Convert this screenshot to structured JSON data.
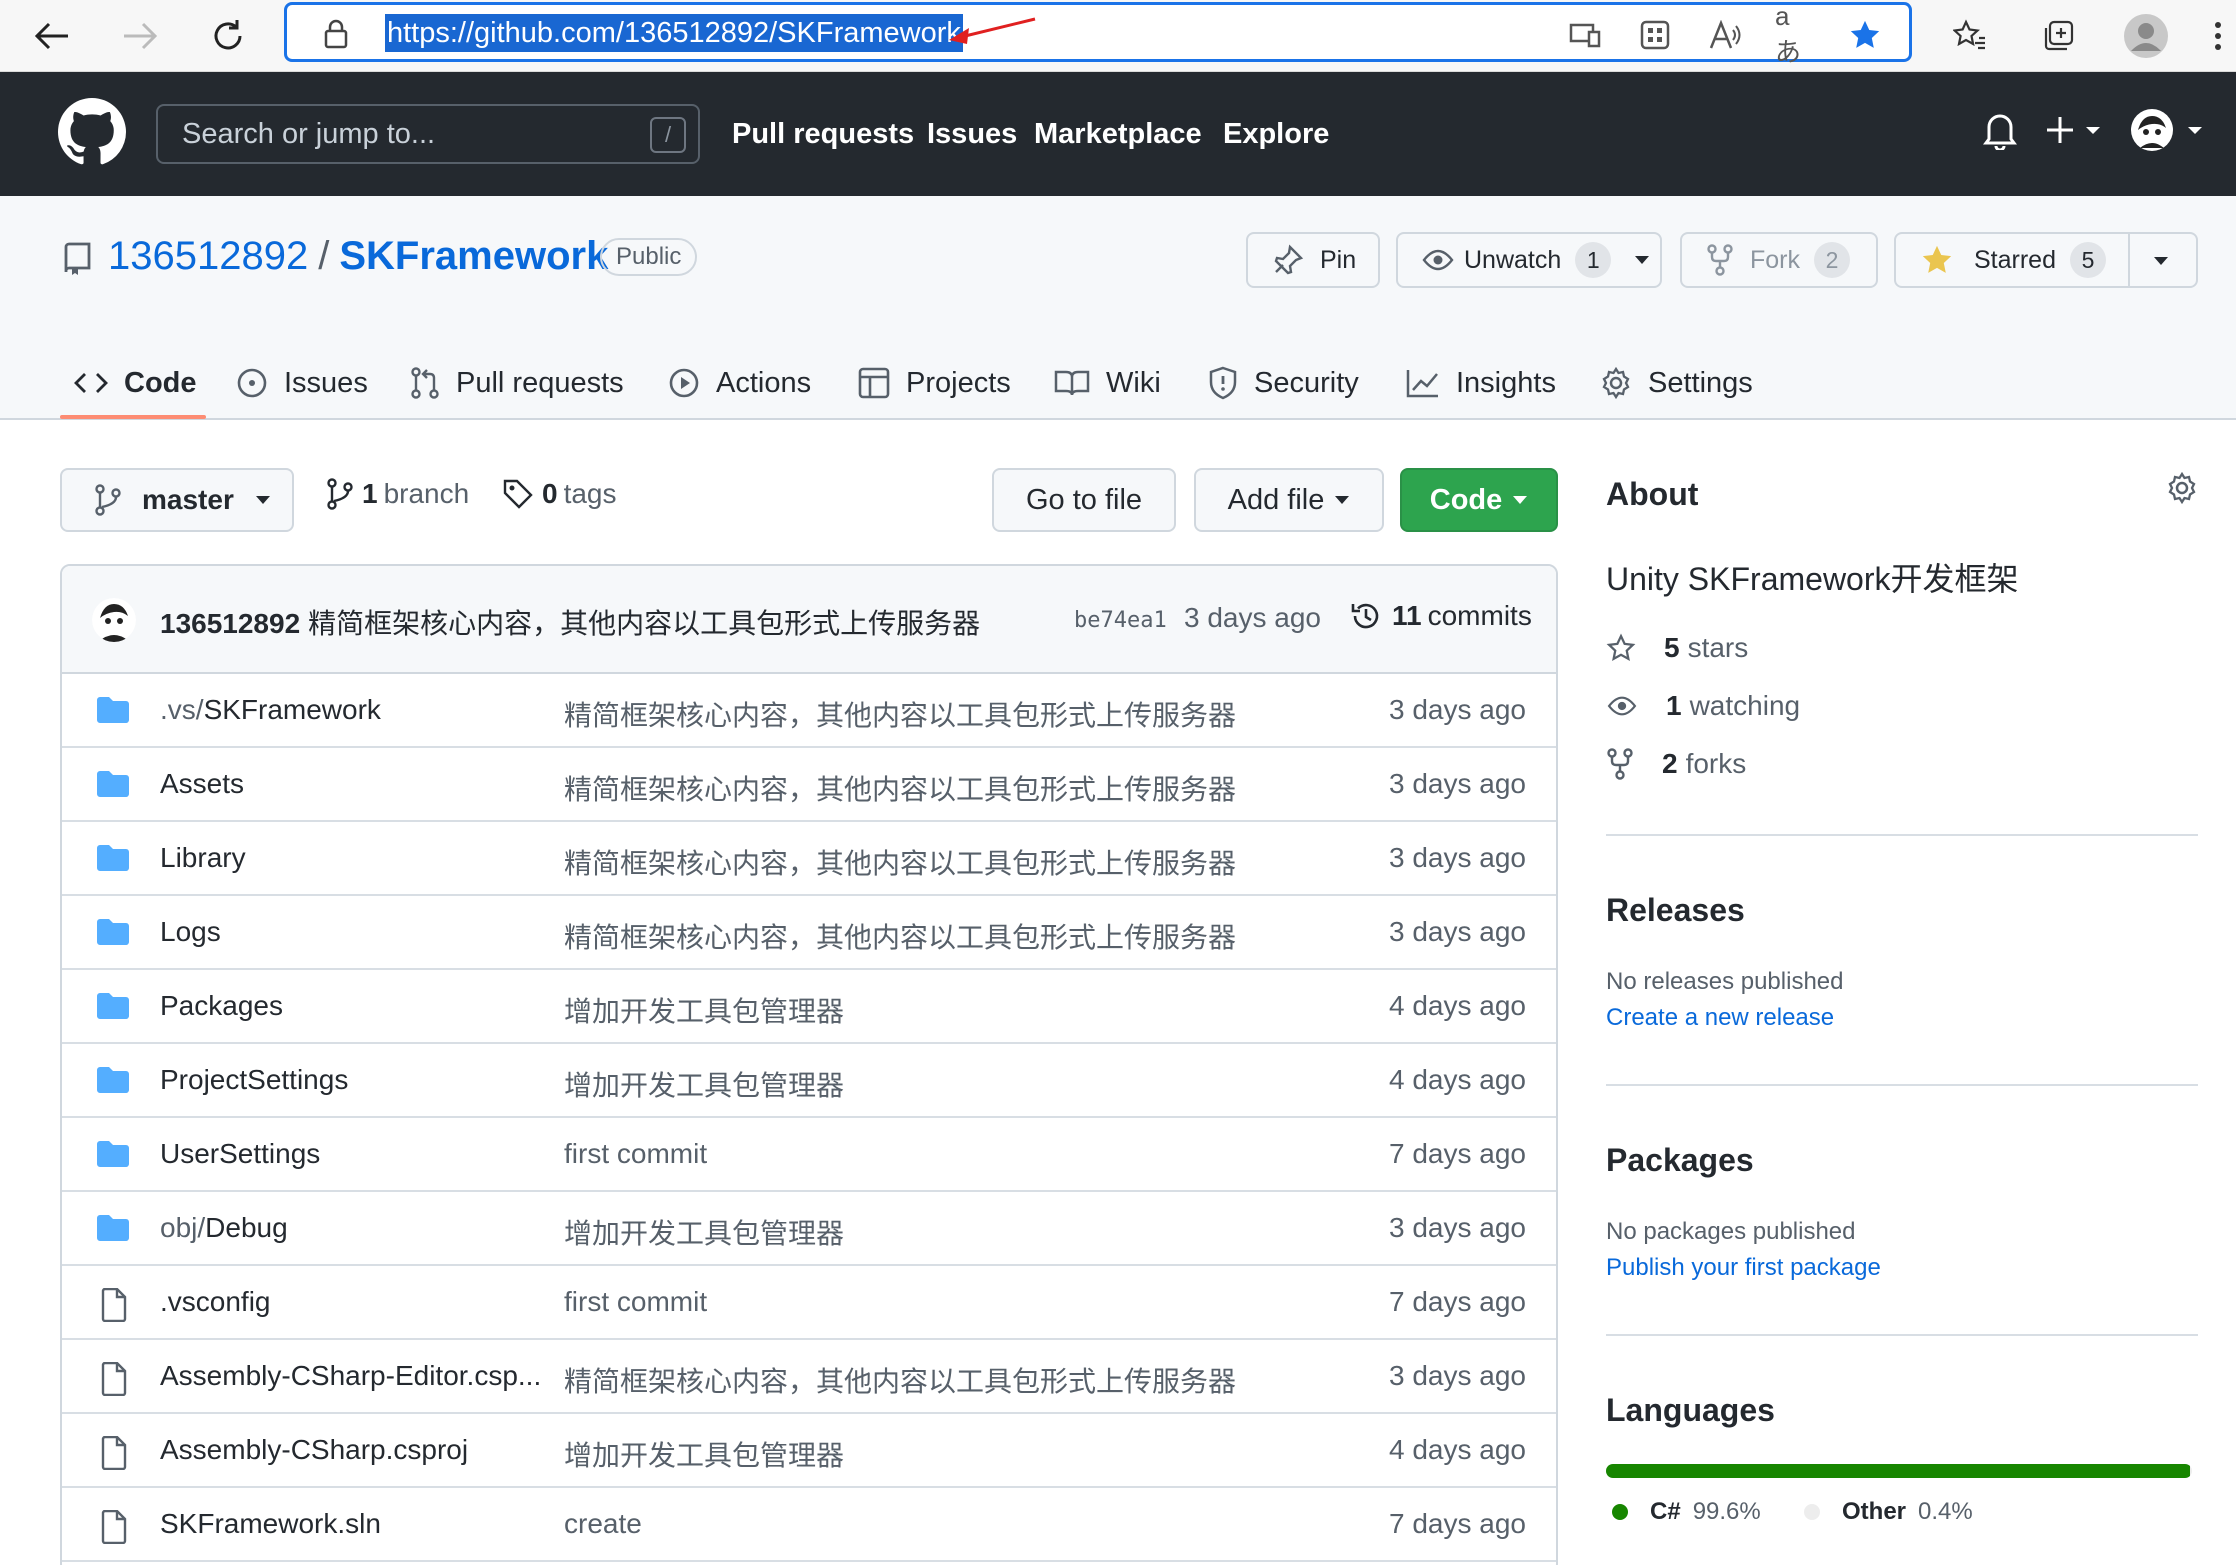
{
  "browser": {
    "url": "https://github.com/136512892/SKFramework",
    "translate_icon_text": "aあ"
  },
  "github_header": {
    "search_placeholder": "Search or jump to...",
    "search_shortcut": "/",
    "nav": [
      "Pull requests",
      "Issues",
      "Marketplace",
      "Explore"
    ]
  },
  "repo": {
    "owner": "136512892",
    "separator": "/",
    "name": "SKFramework",
    "visibility": "Public",
    "pin_label": "Pin",
    "watch_label": "Unwatch",
    "watch_count": "1",
    "fork_label": "Fork",
    "fork_count": "2",
    "star_label": "Starred",
    "star_count": "5"
  },
  "tabs": [
    "Code",
    "Issues",
    "Pull requests",
    "Actions",
    "Projects",
    "Wiki",
    "Security",
    "Insights",
    "Settings"
  ],
  "toolbar": {
    "branch": "master",
    "branch_count": "1",
    "branch_word": "branch",
    "tag_count": "0",
    "tag_word": "tags",
    "go_to_file": "Go to file",
    "add_file": "Add file",
    "code": "Code"
  },
  "latest_commit": {
    "author": "136512892",
    "message": "精简框架核心内容，其他内容以工具包形式上传服务器",
    "sha": "be74ea1",
    "age": "3 days ago",
    "commit_count": "11",
    "commit_word": "commits"
  },
  "files": [
    {
      "type": "dir",
      "dim": ".vs/",
      "name": "SKFramework",
      "message": "精简框架核心内容，其他内容以工具包形式上传服务器",
      "age": "3 days ago"
    },
    {
      "type": "dir",
      "dim": "",
      "name": "Assets",
      "message": "精简框架核心内容，其他内容以工具包形式上传服务器",
      "age": "3 days ago"
    },
    {
      "type": "dir",
      "dim": "",
      "name": "Library",
      "message": "精简框架核心内容，其他内容以工具包形式上传服务器",
      "age": "3 days ago"
    },
    {
      "type": "dir",
      "dim": "",
      "name": "Logs",
      "message": "精简框架核心内容，其他内容以工具包形式上传服务器",
      "age": "3 days ago"
    },
    {
      "type": "dir",
      "dim": "",
      "name": "Packages",
      "message": "增加开发工具包管理器",
      "age": "4 days ago"
    },
    {
      "type": "dir",
      "dim": "",
      "name": "ProjectSettings",
      "message": "增加开发工具包管理器",
      "age": "4 days ago"
    },
    {
      "type": "dir",
      "dim": "",
      "name": "UserSettings",
      "message": "first commit",
      "age": "7 days ago"
    },
    {
      "type": "dir",
      "dim": "obj/",
      "name": "Debug",
      "message": "增加开发工具包管理器",
      "age": "3 days ago"
    },
    {
      "type": "file",
      "dim": "",
      "name": ".vsconfig",
      "message": "first commit",
      "age": "7 days ago"
    },
    {
      "type": "file",
      "dim": "",
      "name": "Assembly-CSharp-Editor.csp...",
      "message": "精简框架核心内容，其他内容以工具包形式上传服务器",
      "age": "3 days ago"
    },
    {
      "type": "file",
      "dim": "",
      "name": "Assembly-CSharp.csproj",
      "message": "增加开发工具包管理器",
      "age": "4 days ago"
    },
    {
      "type": "file",
      "dim": "",
      "name": "SKFramework.sln",
      "message": "create",
      "age": "7 days ago"
    }
  ],
  "about": {
    "title": "About",
    "description": "Unity SKFramework开发框架",
    "stars_count": "5",
    "stars_word": "stars",
    "watching_count": "1",
    "watching_word": "watching",
    "forks_count": "2",
    "forks_word": "forks"
  },
  "releases": {
    "title": "Releases",
    "empty": "No releases published",
    "link": "Create a new release"
  },
  "packages": {
    "title": "Packages",
    "empty": "No packages published",
    "link": "Publish your first package"
  },
  "languages": {
    "title": "Languages",
    "items": [
      {
        "name": "C#",
        "percent": "99.6%",
        "share": 99.6,
        "color": "#178600"
      },
      {
        "name": "Other",
        "percent": "0.4%",
        "share": 0.4,
        "color": "#ededed"
      }
    ]
  },
  "colors": {
    "accent": "#0969da",
    "header_bg": "#24292f",
    "green_button": "#2da44e",
    "tab_underline": "#fd8c73",
    "folder": "#54aeff"
  }
}
